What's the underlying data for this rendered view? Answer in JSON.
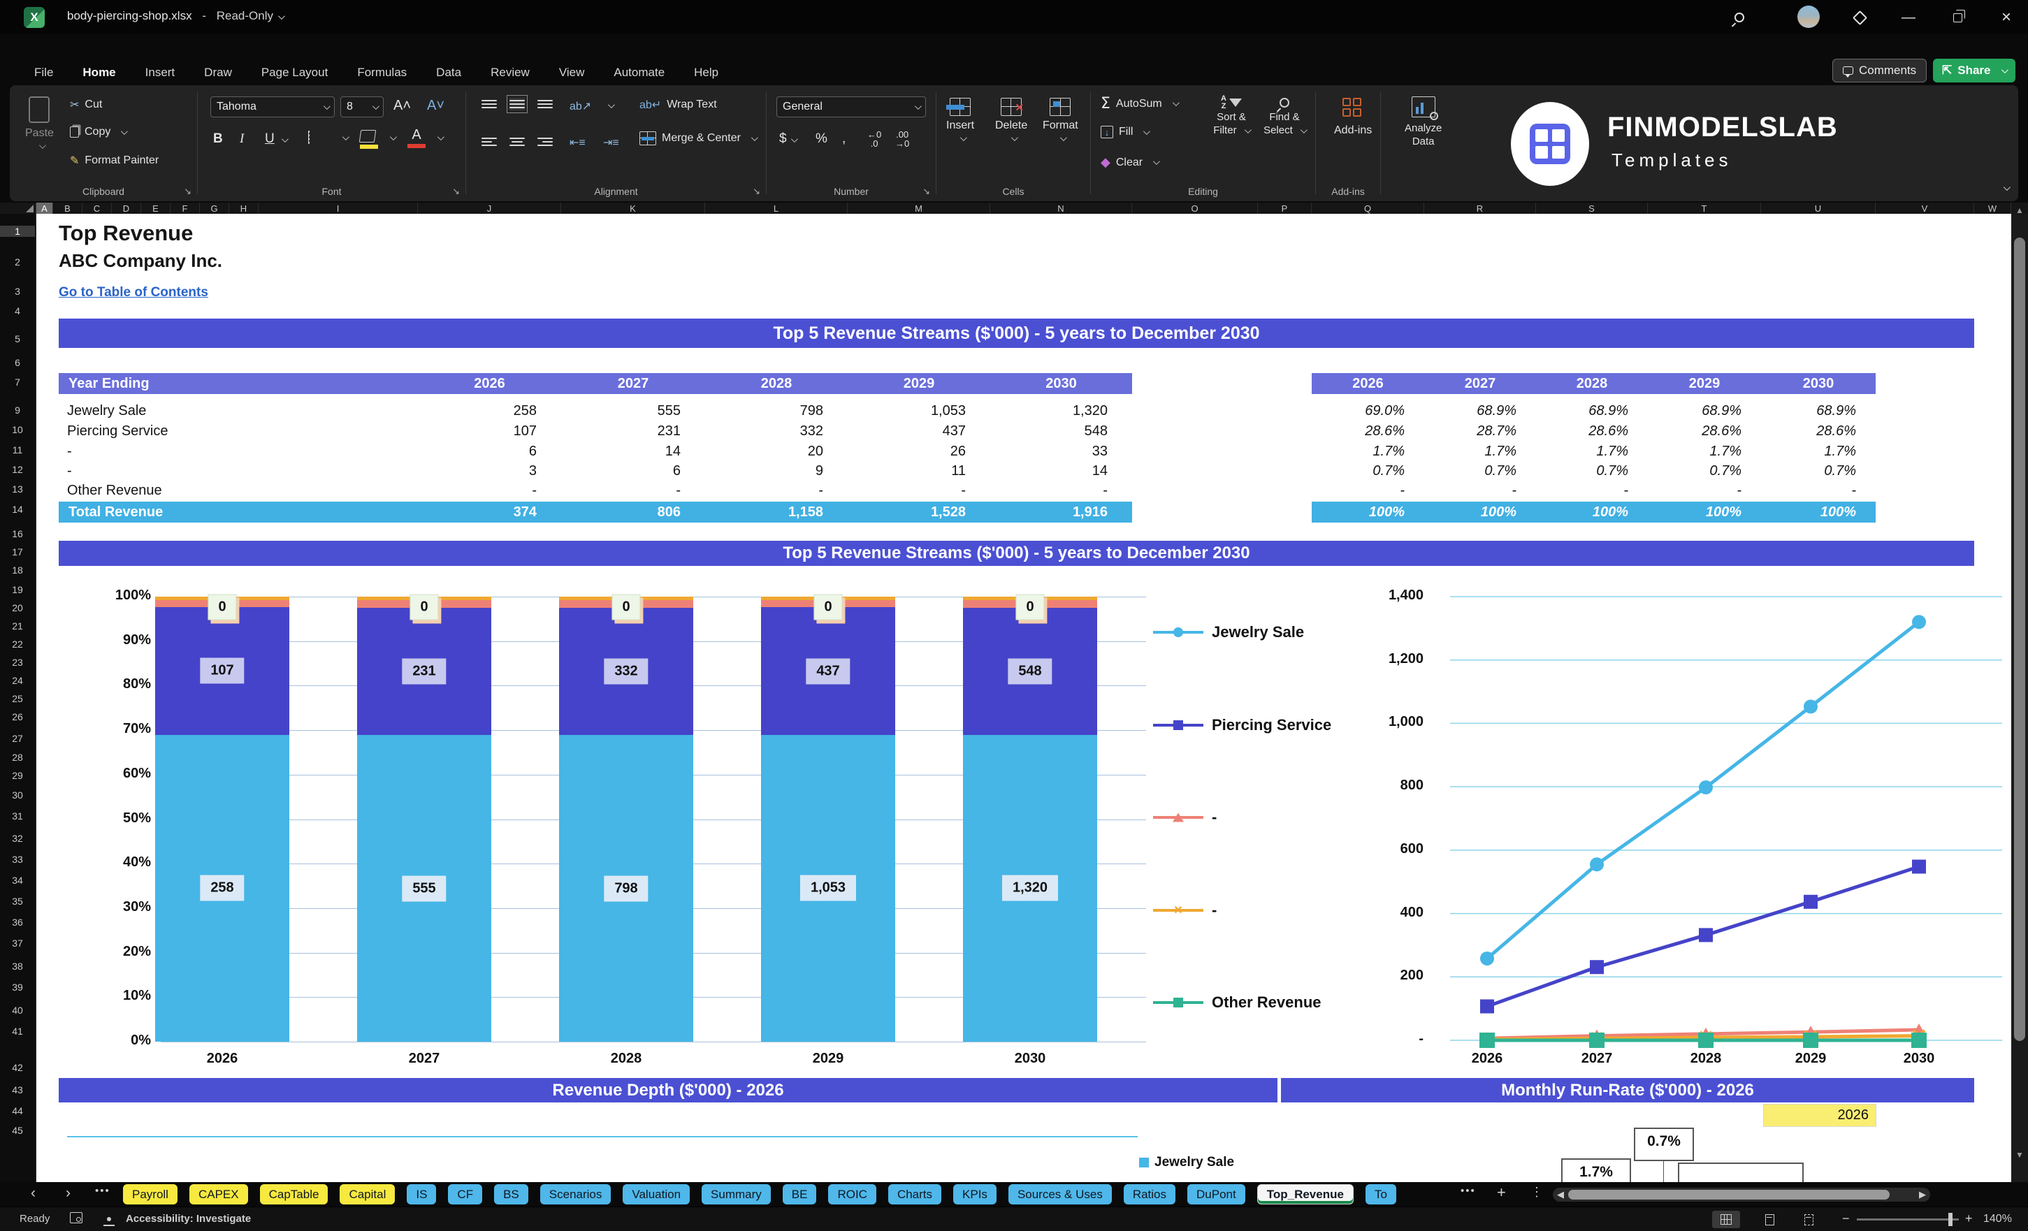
{
  "titlebar": {
    "filename": "body-piercing-shop.xlsx",
    "separator": "-",
    "mode": "Read-Only"
  },
  "menu": {
    "items": [
      "File",
      "Home",
      "Insert",
      "Draw",
      "Page Layout",
      "Formulas",
      "Data",
      "Review",
      "View",
      "Automate",
      "Help"
    ],
    "active_index": 1,
    "comments_label": "Comments",
    "share_label": "Share"
  },
  "ribbon": {
    "clipboard": {
      "label": "Clipboard",
      "paste": "Paste",
      "cut": "Cut",
      "copy": "Copy",
      "format_painter": "Format Painter"
    },
    "font": {
      "label": "Font",
      "font_name": "Tahoma",
      "font_size": "8",
      "bold": "B",
      "italic": "I",
      "underline": "U"
    },
    "alignment": {
      "label": "Alignment",
      "wrap_text": "Wrap Text",
      "merge_center": "Merge & Center"
    },
    "number": {
      "label": "Number",
      "format": "General",
      "currency": "$",
      "percent": "%",
      "comma": ",",
      "dec_left": ".0",
      "dec_right": ".00"
    },
    "cells": {
      "label": "Cells",
      "insert": "Insert",
      "delete": "Delete",
      "format": "Format"
    },
    "editing": {
      "label": "Editing",
      "autosum": "AutoSum",
      "fill": "Fill",
      "clear": "Clear",
      "sort1": "Sort &",
      "sort2": "Filter",
      "find1": "Find &",
      "find2": "Select"
    },
    "addins": {
      "label": "Add-ins",
      "button": "Add-ins",
      "analyze1": "Analyze",
      "analyze2": "Data"
    },
    "logo": {
      "line1": "FINMODELSLAB",
      "line2": "Templates"
    }
  },
  "grid": {
    "columns": [
      "A",
      "B",
      "C",
      "D",
      "E",
      "F",
      "G",
      "H",
      "I",
      "J",
      "K",
      "L",
      "M",
      "N",
      "O",
      "P",
      "Q",
      "R",
      "S",
      "T",
      "U",
      "V",
      "W"
    ],
    "rows": [
      1,
      2,
      3,
      4,
      5,
      6,
      7,
      9,
      10,
      11,
      12,
      13,
      14,
      16,
      17,
      18,
      19,
      20,
      21,
      22,
      23,
      24,
      25,
      26,
      27,
      28,
      29,
      30,
      31,
      32,
      33,
      34,
      35,
      36,
      37,
      38,
      39,
      40,
      41,
      42,
      43,
      44,
      45
    ]
  },
  "sheet": {
    "title": "Top Revenue",
    "company": "ABC Company Inc.",
    "toc_link": "Go to Table of Contents",
    "section1_title": "Top 5 Revenue Streams ($'000) - 5 years to December 2030",
    "section2_title": "Top 5 Revenue Streams ($'000) - 5 years to December 2030",
    "section3_title": "Revenue Depth ($'000) - 2026",
    "section4_title": "Monthly Run-Rate ($'000) - 2026",
    "table": {
      "row_header": "Year Ending",
      "years": [
        "2026",
        "2027",
        "2028",
        "2029",
        "2030"
      ],
      "rows": [
        {
          "label": "Jewelry Sale",
          "values": [
            "258",
            "555",
            "798",
            "1,053",
            "1,320"
          ]
        },
        {
          "label": "Piercing Service",
          "values": [
            "107",
            "231",
            "332",
            "437",
            "548"
          ]
        },
        {
          "label": "-",
          "values": [
            "6",
            "14",
            "20",
            "26",
            "33"
          ]
        },
        {
          "label": "-",
          "values": [
            "3",
            "6",
            "9",
            "11",
            "14"
          ]
        },
        {
          "label": "Other Revenue",
          "values": [
            "-",
            "-",
            "-",
            "-",
            "-"
          ]
        }
      ],
      "total_label": "Total Revenue",
      "total_values": [
        "374",
        "806",
        "1,158",
        "1,528",
        "1,916"
      ]
    },
    "pct_table": {
      "years": [
        "2026",
        "2027",
        "2028",
        "2029",
        "2030"
      ],
      "rows": [
        [
          "69.0%",
          "68.9%",
          "68.9%",
          "68.9%",
          "68.9%"
        ],
        [
          "28.6%",
          "28.7%",
          "28.6%",
          "28.6%",
          "28.6%"
        ],
        [
          "1.7%",
          "1.7%",
          "1.7%",
          "1.7%",
          "1.7%"
        ],
        [
          "0.7%",
          "0.7%",
          "0.7%",
          "0.7%",
          "0.7%"
        ],
        [
          "-",
          "-",
          "-",
          "-",
          "-"
        ]
      ],
      "total_values": [
        "100%",
        "100%",
        "100%",
        "100%",
        "100%"
      ]
    },
    "runrate": {
      "year_cell": "2026",
      "callout_top": "0.7%",
      "callout_partial": "1.7%"
    },
    "depth_legend": "Jewelry Sale"
  },
  "chart_data": [
    {
      "type": "bar",
      "subtype": "stacked-100pct",
      "title": "Top 5 Revenue Streams ($'000) - 5 years to December 2030",
      "categories": [
        "2026",
        "2027",
        "2028",
        "2029",
        "2030"
      ],
      "series": [
        {
          "name": "Jewelry Sale",
          "color": "#45b6e6",
          "values": [
            258,
            555,
            798,
            1053,
            1320
          ],
          "labels": [
            "258",
            "555",
            "798",
            "1,053",
            "1,320"
          ]
        },
        {
          "name": "Piercing Service",
          "color": "#4543c9",
          "values": [
            107,
            231,
            332,
            437,
            548
          ],
          "labels": [
            "107",
            "231",
            "332",
            "437",
            "548"
          ]
        },
        {
          "name": "-",
          "color": "#ee8176",
          "values": [
            6,
            14,
            20,
            26,
            33
          ]
        },
        {
          "name": "-",
          "color": "#f0a832",
          "values": [
            3,
            6,
            9,
            11,
            14
          ]
        },
        {
          "name": "Other Revenue",
          "color": "#2fb392",
          "values": [
            0,
            0,
            0,
            0,
            0
          ],
          "top_label": "0"
        }
      ],
      "yticks": [
        "0%",
        "10%",
        "20%",
        "30%",
        "40%",
        "50%",
        "60%",
        "70%",
        "80%",
        "90%",
        "100%"
      ],
      "ylim": [
        0,
        1
      ],
      "grid": true,
      "legend_position": "right"
    },
    {
      "type": "line",
      "categories": [
        "2026",
        "2027",
        "2028",
        "2029",
        "2030"
      ],
      "series": [
        {
          "name": "Jewelry Sale",
          "color": "#45b6e6",
          "marker": "circle",
          "values": [
            258,
            555,
            798,
            1053,
            1320
          ]
        },
        {
          "name": "Piercing Service",
          "color": "#4543c9",
          "marker": "square",
          "values": [
            107,
            231,
            332,
            437,
            548
          ]
        },
        {
          "name": "-",
          "color": "#ee8176",
          "marker": "triangle",
          "values": [
            6,
            14,
            20,
            26,
            33
          ]
        },
        {
          "name": "-",
          "color": "#f0a832",
          "marker": "x",
          "values": [
            3,
            6,
            9,
            11,
            14
          ]
        },
        {
          "name": "Other Revenue",
          "color": "#2fb392",
          "marker": "square",
          "values": [
            0,
            0,
            0,
            0,
            0
          ]
        }
      ],
      "yticks": [
        "-",
        "200",
        "400",
        "600",
        "800",
        "1,000",
        "1,200",
        "1,400"
      ],
      "ylim": [
        0,
        1400
      ],
      "grid": true
    }
  ],
  "tabs": {
    "items": [
      {
        "label": "Payroll",
        "type": "yellow"
      },
      {
        "label": "CAPEX",
        "type": "yellow"
      },
      {
        "label": "CapTable",
        "type": "yellow"
      },
      {
        "label": "Capital",
        "type": "yellow"
      },
      {
        "label": "IS",
        "type": "blue"
      },
      {
        "label": "CF",
        "type": "blue"
      },
      {
        "label": "BS",
        "type": "blue"
      },
      {
        "label": "Scenarios",
        "type": "blue"
      },
      {
        "label": "Valuation",
        "type": "blue"
      },
      {
        "label": "Summary",
        "type": "blue"
      },
      {
        "label": "BE",
        "type": "blue"
      },
      {
        "label": "ROIC",
        "type": "blue"
      },
      {
        "label": "Charts",
        "type": "blue"
      },
      {
        "label": "KPIs",
        "type": "blue"
      },
      {
        "label": "Sources & Uses",
        "type": "blue"
      },
      {
        "label": "Ratios",
        "type": "blue"
      },
      {
        "label": "DuPont",
        "type": "blue"
      },
      {
        "label": "Top_Revenue",
        "type": "active"
      },
      {
        "label": "To",
        "type": "blue-cut"
      }
    ]
  },
  "statusbar": {
    "ready": "Ready",
    "accessibility": "Accessibility: Investigate",
    "zoom": "140%"
  }
}
